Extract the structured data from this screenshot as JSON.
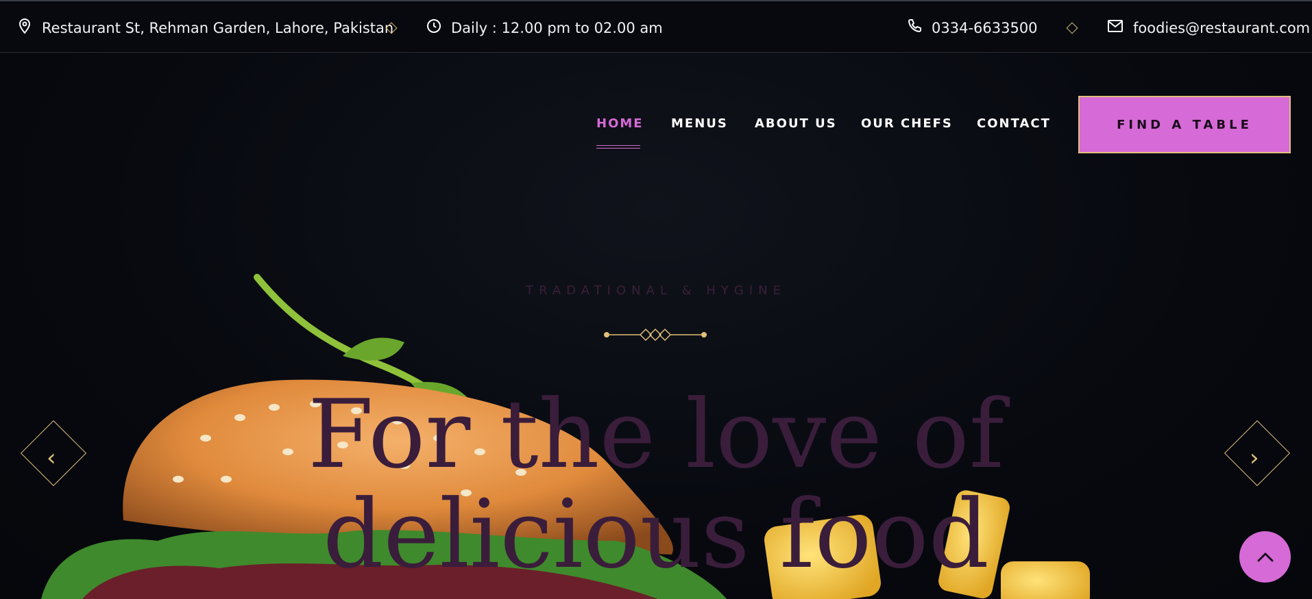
{
  "topbar": {
    "address": "Restaurant St, Rehman Garden, Lahore, Pakistan",
    "hours": "Daily : 12.00 pm to 02.00 am",
    "phone": "0334-6633500",
    "email": "foodies@restaurant.com"
  },
  "nav": {
    "items": [
      {
        "label": "HOME",
        "active": true
      },
      {
        "label": "MENUS"
      },
      {
        "label": "ABOUT US"
      },
      {
        "label": "OUR CHEFS"
      },
      {
        "label": "CONTACT"
      }
    ],
    "cta_label": "FIND A TABLE"
  },
  "hero": {
    "subtitle": "TRADATIONAL & HYGINE",
    "title_line1": "For the love of",
    "title_line2": "delicious food"
  },
  "icons": {
    "address": "map-pin-icon",
    "hours": "clock-icon",
    "phone": "phone-icon",
    "email": "mail-icon",
    "prev": "chevron-left-icon",
    "next": "chevron-right-icon",
    "scroll_top": "chevron-up-icon"
  },
  "colors": {
    "accent": "#d66ad6",
    "gold": "#e2bf7a",
    "background": "#07090f",
    "hero_text": "#3a1d3b"
  }
}
